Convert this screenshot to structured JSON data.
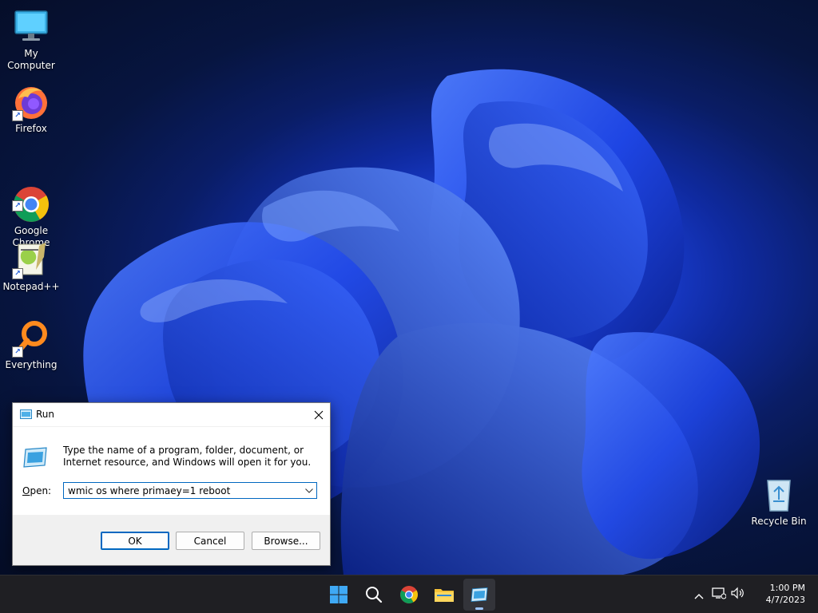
{
  "desktop": {
    "icons": [
      {
        "label": "My Computer",
        "icon": "monitor-icon",
        "shortcut": false
      },
      {
        "label": "Firefox",
        "icon": "firefox-icon",
        "shortcut": true
      },
      {
        "label": "Google\nChrome",
        "icon": "chrome-icon",
        "shortcut": true
      },
      {
        "label": "Notepad++",
        "icon": "notepadpp-icon",
        "shortcut": true
      },
      {
        "label": "Everything",
        "icon": "magnifier-icon",
        "shortcut": true
      }
    ],
    "recycle_bin": {
      "label": "Recycle Bin",
      "icon": "recycle-bin-icon"
    }
  },
  "run_dialog": {
    "title": "Run",
    "close_icon": "close-icon",
    "description": "Type the name of a program, folder, document, or Internet resource, and Windows will open it for you.",
    "open_label_prefix": "",
    "open_label_underline": "O",
    "open_label_rest": "pen:",
    "input_value": "wmic os where primaey=1 reboot",
    "buttons": {
      "ok": "OK",
      "cancel": "Cancel",
      "browse": "Browse..."
    }
  },
  "taskbar": {
    "apps": [
      "start-icon",
      "search-icon",
      "chrome-icon",
      "file-explorer-icon",
      "run-icon"
    ],
    "active_app": "run-icon",
    "tray": [
      "chevron-up-icon",
      "network-icon",
      "volume-icon"
    ],
    "time": "1:00 PM",
    "date": "4/7/2023"
  },
  "colors": {
    "accent": "#0067c0",
    "taskbar": "#1f1f23",
    "dialog_bg": "#f0f0f0"
  }
}
